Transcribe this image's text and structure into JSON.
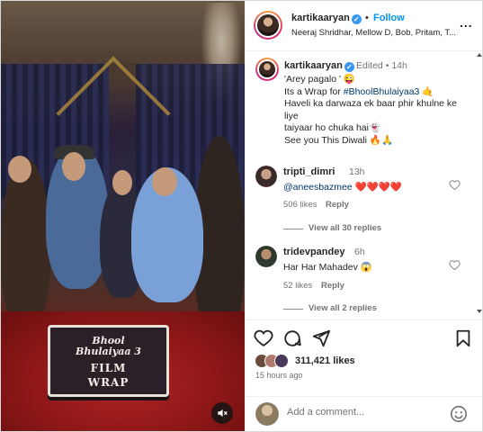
{
  "post": {
    "username": "kartikaaryan",
    "follow_label": "Follow",
    "dot": "•",
    "subtitle": "Neeraj Shridhar, Mellow D, Bob, Pritam, T...",
    "more": "...",
    "verified_mark": "✓"
  },
  "media": {
    "cake_line1": "Bhool",
    "cake_line2": "Bhulaiyaa 3",
    "cake_line3": "FILM",
    "cake_line4": "WRAP",
    "mute_icon": "speaker-muted-icon"
  },
  "caption": {
    "username": "kartikaaryan",
    "edited": "Edited",
    "dot": "•",
    "time": "14h",
    "line1": "'Arey pagalo ' 😜",
    "line2_prefix": "Its a Wrap for ",
    "line2_tag": "#BhoolBhulaiyaa3",
    "line2_suffix": " 🤙",
    "line3": "Haveli ka darwaza ek baar phir khulne ke liye",
    "line4": "taiyaar ho chuka hai👻",
    "line5": "See you This Diwali 🔥🙏"
  },
  "comments": [
    {
      "username": "tripti_dimri",
      "time": "13h",
      "mention": "@aneesbazmee",
      "text": " ❤️❤️❤️❤️",
      "likes": "506 likes",
      "reply": "Reply",
      "view_replies": "View all 30 replies"
    },
    {
      "username": "tridevpandey",
      "time": "6h",
      "mention": "",
      "text": "Har Har Mahadev 😱",
      "likes": "52 likes",
      "reply": "Reply",
      "view_replies": "View all 2 replies"
    }
  ],
  "actions": {
    "likes_count": "311,421 likes",
    "posted_ago": "15 hours ago"
  },
  "add_comment": {
    "placeholder": "Add a comment..."
  },
  "colors": {
    "accent": "#0095f6",
    "verified": "#3897f0",
    "heart_red": "#ed4956"
  }
}
